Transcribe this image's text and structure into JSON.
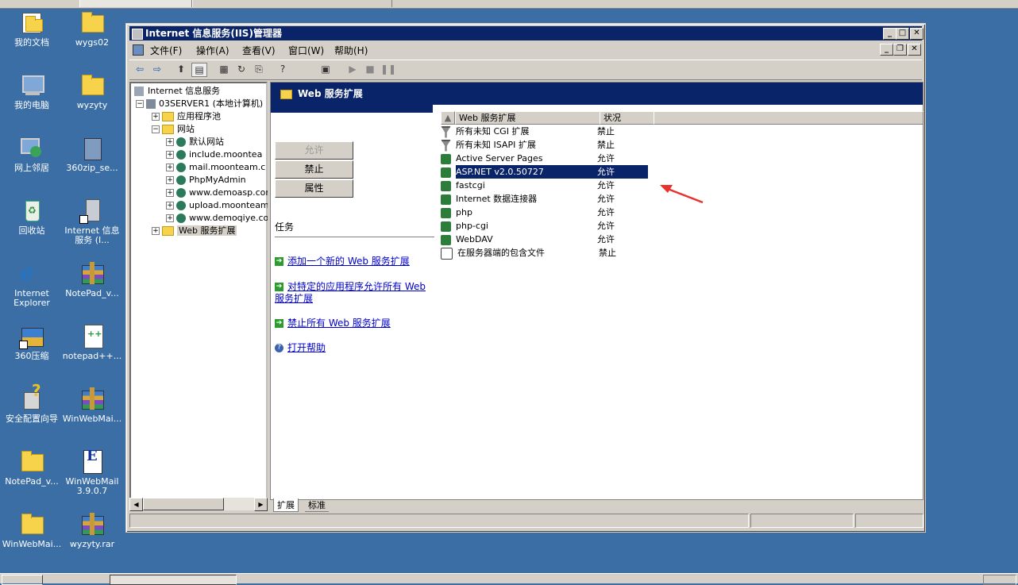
{
  "desktop": {
    "icons": [
      {
        "label": "我的文档",
        "icon": "my-documents-icon"
      },
      {
        "label": "wygs02",
        "icon": "folder-icon"
      },
      {
        "label": "我的电脑",
        "icon": "my-computer-icon"
      },
      {
        "label": "wyzyty",
        "icon": "folder-icon"
      },
      {
        "label": "网上邻居",
        "icon": "network-places-icon"
      },
      {
        "label": "360zip_se...",
        "icon": "installer-icon"
      },
      {
        "label": "回收站",
        "icon": "recycle-bin-icon"
      },
      {
        "label": "Internet 信息服务 (I...",
        "icon": "iis-shortcut-icon"
      },
      {
        "label": "Internet Explorer",
        "icon": "ie-icon"
      },
      {
        "label": "NotePad_v...",
        "icon": "rar-archive-icon"
      },
      {
        "label": "360压缩",
        "icon": "zip-shortcut-icon"
      },
      {
        "label": "notepad++...",
        "icon": "notepadpp-icon"
      },
      {
        "label": "安全配置向导",
        "icon": "security-wizard-icon"
      },
      {
        "label": "WinWebMai...",
        "icon": "rar-archive-icon"
      },
      {
        "label": "NotePad_v...",
        "icon": "folder-icon"
      },
      {
        "label": "WinWebMail 3.9.0.7",
        "icon": "winwebmail-icon"
      },
      {
        "label": "WinWebMai...",
        "icon": "folder-icon"
      },
      {
        "label": "wyzyty.rar",
        "icon": "rar-archive-icon"
      }
    ]
  },
  "window": {
    "title": "Internet 信息服务(IIS)管理器",
    "menu": [
      "文件(F)",
      "操作(A)",
      "查看(V)",
      "窗口(W)",
      "帮助(H)"
    ],
    "tree": {
      "root": "Internet 信息服务",
      "server": "03SERVER1 (本地计算机)",
      "app_pools": "应用程序池",
      "websites": "网站",
      "sites": [
        "默认网站",
        "include.moontea",
        "mail.moonteam.c",
        "PhpMyAdmin",
        "www.demoasp.com",
        "upload.moonteam",
        "www.demoqiye.co"
      ],
      "web_ext": "Web 服务扩展"
    },
    "panel": {
      "header": "Web 服务扩展",
      "buttons": {
        "allow": "允许",
        "prohibit": "禁止",
        "properties": "属性"
      },
      "tasks_label": "任务",
      "tasks": [
        "添加一个新的 Web 服务扩展",
        "对特定的应用程序允许所有 Web 服务扩展",
        "禁止所有 Web 服务扩展",
        "打开帮助"
      ]
    },
    "list": {
      "columns": {
        "name": "Web 服务扩展",
        "status": "状况"
      },
      "rows": [
        {
          "name": "所有未知 CGI 扩展",
          "status": "禁止",
          "icon": "filter-icon"
        },
        {
          "name": "所有未知 ISAPI 扩展",
          "status": "禁止",
          "icon": "filter-icon"
        },
        {
          "name": "Active Server Pages",
          "status": "允许",
          "icon": "extension-allowed-icon"
        },
        {
          "name": "ASP.NET v2.0.50727",
          "status": "允许",
          "icon": "extension-allowed-icon",
          "selected": true
        },
        {
          "name": "fastcgi",
          "status": "允许",
          "icon": "extension-allowed-icon"
        },
        {
          "name": "Internet 数据连接器",
          "status": "允许",
          "icon": "extension-allowed-icon"
        },
        {
          "name": "php",
          "status": "允许",
          "icon": "extension-allowed-icon"
        },
        {
          "name": "php-cgi",
          "status": "允许",
          "icon": "extension-allowed-icon"
        },
        {
          "name": "WebDAV",
          "status": "允许",
          "icon": "extension-allowed-icon"
        },
        {
          "name": "在服务器端的包含文件",
          "status": "禁止",
          "icon": "extension-prohibited-icon"
        }
      ]
    },
    "tabs": {
      "extended": "扩展",
      "standard": "标准"
    }
  },
  "colors": {
    "desktop": "#3a6ea5",
    "titlebar": "#0a246a",
    "selection": "#0a246a",
    "annotation_arrow": "#e8322c"
  }
}
